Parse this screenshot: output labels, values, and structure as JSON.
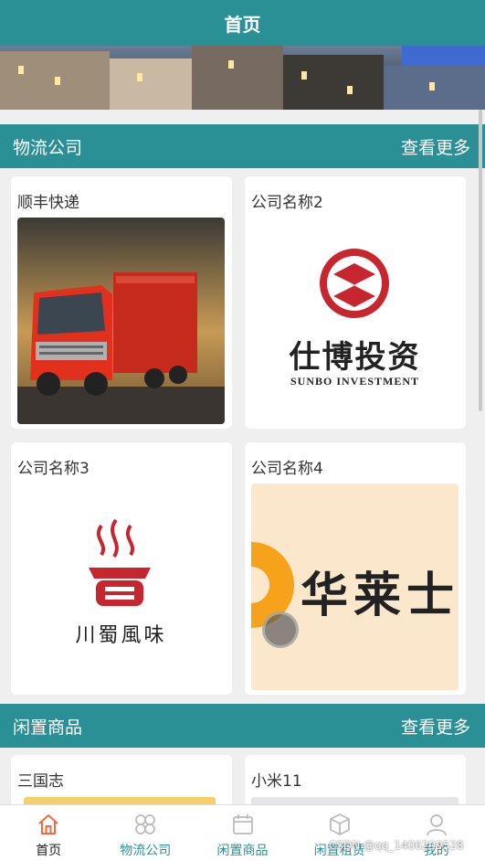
{
  "header": {
    "title": "首页"
  },
  "logistics": {
    "title": "物流公司",
    "more": "查看更多",
    "items": [
      {
        "name": "顺丰快递"
      },
      {
        "name": "公司名称2",
        "logo_text": "仕博投资",
        "logo_sub": "SUNBO INVESTMENT"
      },
      {
        "name": "公司名称3",
        "logo_text": "川蜀風味"
      },
      {
        "name": "公司名称4",
        "logo_text": "华莱士"
      }
    ]
  },
  "idle": {
    "title": "闲置商品",
    "more": "查看更多",
    "items": [
      {
        "name": "三国志"
      },
      {
        "name": "小米11"
      }
    ]
  },
  "nav": {
    "items": [
      {
        "label": "首页",
        "icon": "home-icon",
        "active": true
      },
      {
        "label": "物流公司",
        "icon": "grid-icon"
      },
      {
        "label": "闲置商品",
        "icon": "calendar-icon"
      },
      {
        "label": "闲置租赁",
        "icon": "box-icon"
      },
      {
        "label": "我的",
        "icon": "user-icon"
      }
    ]
  },
  "watermark": "CSDN @qq_1406299528",
  "colors": {
    "primary": "#2b8f96",
    "nav_active": "#f36a3c"
  }
}
